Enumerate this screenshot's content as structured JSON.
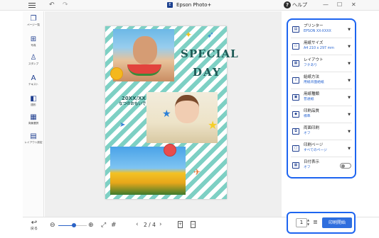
{
  "titlebar": {
    "app_title": "Epson Photo+",
    "app_icon": "epson-app-icon",
    "help_label": "ヘルプ",
    "menu_icon": "hamburger-menu-icon",
    "undo_icon": "undo-icon",
    "redo_icon": "redo-icon",
    "minimize_icon": "minimize-icon",
    "maximize_icon": "maximize-icon",
    "close_icon": "close-icon"
  },
  "left_toolbar": {
    "items": [
      {
        "label": "ページ一覧",
        "icon": "page-list-icon"
      },
      {
        "label": "写真",
        "icon": "add-photo-icon"
      },
      {
        "label": "スタンプ",
        "icon": "stamp-icon"
      },
      {
        "label": "テキスト",
        "icon": "text-icon"
      },
      {
        "label": "図形",
        "icon": "shape-icon"
      },
      {
        "label": "背景選択",
        "icon": "background-icon"
      },
      {
        "label": "レイアウト設定",
        "icon": "layout-icon"
      }
    ]
  },
  "page_content": {
    "special_text": "SPECIAL",
    "day_text": "DAY",
    "memo_date": "20XX/XX",
    "memo_caption": "なつのおもいで"
  },
  "settings": {
    "rows": [
      {
        "title": "プリンター",
        "value": "EPSON XX-XXXX",
        "icon": "printer-icon"
      },
      {
        "title": "用紙サイズ",
        "value": "A4 210 x 297 mm",
        "icon": "paper-size-icon"
      },
      {
        "title": "レイアウト",
        "value": "フチあり",
        "icon": "layout-icon"
      },
      {
        "title": "給紙方法",
        "value": "用紙背面給紙",
        "icon": "paper-feed-icon"
      },
      {
        "title": "用紙種類",
        "value": "普通紙",
        "icon": "paper-type-icon"
      },
      {
        "title": "印刷品質",
        "value": "標準",
        "icon": "print-quality-icon"
      },
      {
        "title": "両面印刷",
        "value": "オフ",
        "icon": "duplex-icon"
      },
      {
        "title": "印刷ページ",
        "value": "すべてのページ",
        "icon": "print-pages-icon"
      },
      {
        "title": "日付表示",
        "value": "オフ",
        "icon": "date-icon"
      }
    ],
    "date_toggle_on": false
  },
  "bottom_bar": {
    "back_label": "戻る",
    "zoom_level": 0.55,
    "page_indicator": "2 / 4",
    "copies": "1",
    "print_button": "印刷開始"
  },
  "colors": {
    "accent_blue": "#1d64f0",
    "print_button": "#2f6ede",
    "stripe_teal": "#7ed0c4"
  }
}
